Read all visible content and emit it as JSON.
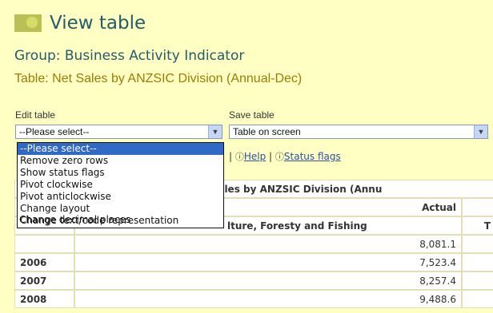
{
  "header": {
    "title": "View table",
    "group": "Group: Business Activity Indicator",
    "table": "Table: Net Sales by ANZSIC Division (Annual-Dec)"
  },
  "edit_table": {
    "label": "Edit table",
    "selected": "--Please select--",
    "options": [
      "--Please select--",
      "Remove zero rows",
      "Show status flags",
      "Pivot clockwise",
      "Pivot anticlockwise",
      "Change layout",
      "Change text/code representation",
      "Change decimal places"
    ]
  },
  "save_table": {
    "label": "Save table",
    "selected": "Table on screen"
  },
  "links": {
    "help": "Help",
    "status_flags": "Status flags"
  },
  "table": {
    "header_main": "Net Sales by ANZSIC Division (Annu",
    "header_sub": "Actual",
    "column_header": "lture, Foresty and Fishing",
    "column_header_extra": "T",
    "rows": [
      {
        "year": "",
        "value": "8,081.1"
      },
      {
        "year": "2006",
        "value": "7,523.4"
      },
      {
        "year": "2007",
        "value": "8,257.4"
      },
      {
        "year": "2008",
        "value": "9,488.6"
      }
    ]
  },
  "colors": {
    "page_bg": "#ffffc4",
    "title": "#235c6b",
    "table_name": "#9a7d00",
    "selection": "#3169c6"
  }
}
